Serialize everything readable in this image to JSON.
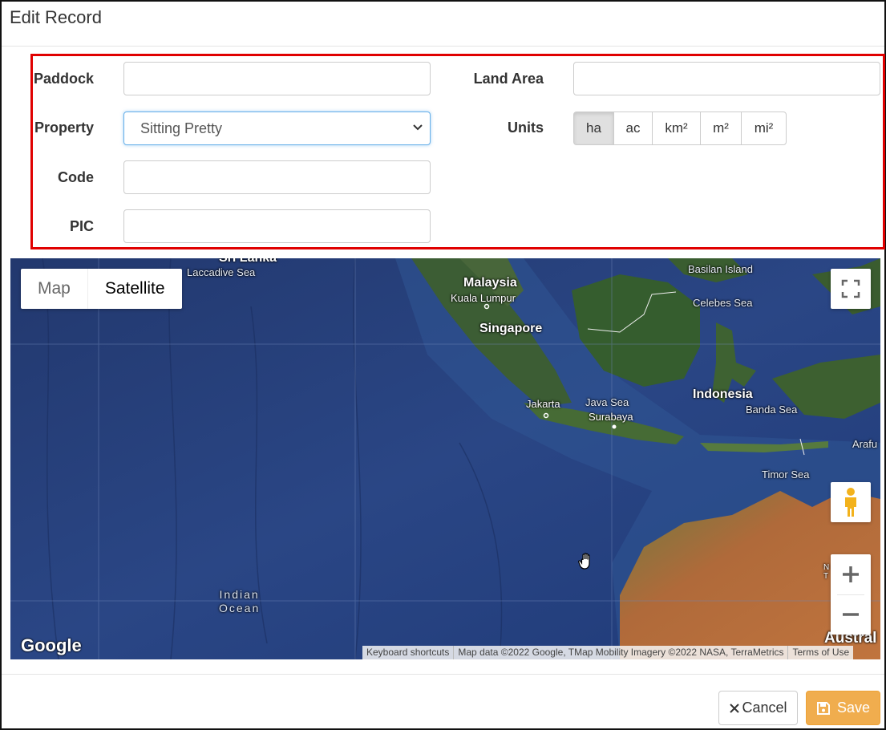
{
  "dialog": {
    "title": "Edit Record"
  },
  "form": {
    "paddock": {
      "label": "Paddock",
      "value": ""
    },
    "property": {
      "label": "Property",
      "value": "Sitting Pretty"
    },
    "code": {
      "label": "Code",
      "value": ""
    },
    "pic": {
      "label": "PIC",
      "value": ""
    },
    "land_area": {
      "label": "Land Area",
      "value": ""
    },
    "units": {
      "label": "Units",
      "options": [
        "ha",
        "ac",
        "km²",
        "m²",
        "mi²"
      ],
      "selected": "ha"
    }
  },
  "map": {
    "map_type_options": [
      "Map",
      "Satellite"
    ],
    "selected_map_type": "Satellite",
    "labels": {
      "sri_lanka": "Sri Lanka",
      "laccadive_sea": "Laccadive Sea",
      "malaysia": "Malaysia",
      "kuala_lumpur": "Kuala Lumpur",
      "singapore": "Singapore",
      "basilan_island": "Basilan Island",
      "celebes_sea": "Celebes Sea",
      "jakarta": "Jakarta",
      "java_sea": "Java Sea",
      "surabaya": "Surabaya",
      "indonesia": "Indonesia",
      "banda_sea": "Banda Sea",
      "arafura": "Arafu",
      "timor_sea": "Timor Sea",
      "indian_ocean_1": "Indian",
      "indian_ocean_2": "Ocean",
      "australia": "Austral",
      "nt": "N",
      "nt2": "T"
    },
    "logo": "Google",
    "attribution": [
      "Keyboard shortcuts",
      "Map data ©2022 Google, TMap Mobility Imagery ©2022 NASA, TerraMetrics",
      "Terms of Use"
    ],
    "icons": {
      "fullscreen": "fullscreen-icon",
      "pegman": "pegman-icon",
      "zoom_in": "plus-icon",
      "zoom_out": "minus-icon",
      "cursor": "hand-cursor-icon"
    }
  },
  "footer": {
    "cancel_label": "Cancel",
    "save_label": "Save",
    "save_color": "#f0ad4e"
  }
}
